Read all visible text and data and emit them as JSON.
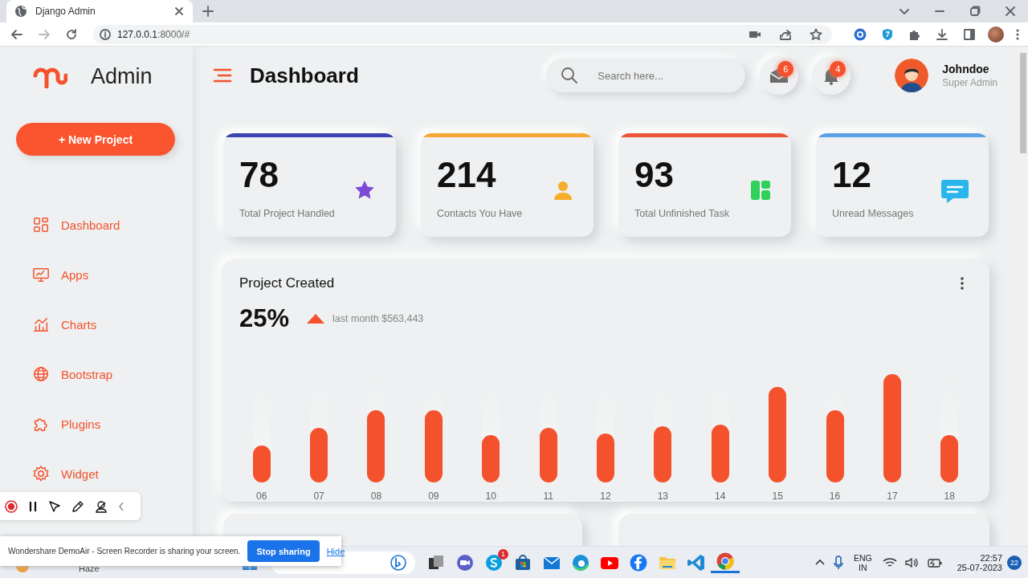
{
  "browser": {
    "tab_title": "Django Admin",
    "url_host": "127.0.0.1",
    "url_path": ":8000/#"
  },
  "sidebar": {
    "brand": "Admin",
    "new_button": "+ New Project",
    "items": [
      {
        "label": "Dashboard"
      },
      {
        "label": "Apps"
      },
      {
        "label": "Charts"
      },
      {
        "label": "Bootstrap"
      },
      {
        "label": "Plugins"
      },
      {
        "label": "Widget"
      }
    ]
  },
  "header": {
    "title": "Dashboard",
    "search": {
      "placeholder": "Search here..."
    },
    "mail_count": "6",
    "notification_count": "4",
    "user": {
      "name": "Johndoe",
      "role": "Super Admin"
    }
  },
  "stats": [
    {
      "value": "78",
      "label": "Total Project Handled",
      "color": "#3c44b4"
    },
    {
      "value": "214",
      "label": "Contacts You Have",
      "color": "#f5a833"
    },
    {
      "value": "93",
      "label": "Total Unfinished Task",
      "color": "#ec5438"
    },
    {
      "value": "12",
      "label": "Unread Messages",
      "color": "#5b9fe6"
    }
  ],
  "project_chart": {
    "title": "Project Created",
    "percent": "25%",
    "note": "last month $563,443",
    "x_labels": [
      "06",
      "07",
      "08",
      "09",
      "10",
      "11",
      "12",
      "13",
      "14",
      "15",
      "16",
      "17",
      "18"
    ]
  },
  "share_notice": {
    "message": "Wondershare DemoAir - Screen Recorder is sharing your screen.",
    "stop_button": "Stop sharing",
    "hide_link": "Hide"
  },
  "taskbar": {
    "weather": "Haze",
    "skype_badge": "1",
    "language": "ENG",
    "region": "IN",
    "time": "22:57",
    "date": "25-07-2023",
    "notification_count": "22"
  }
}
